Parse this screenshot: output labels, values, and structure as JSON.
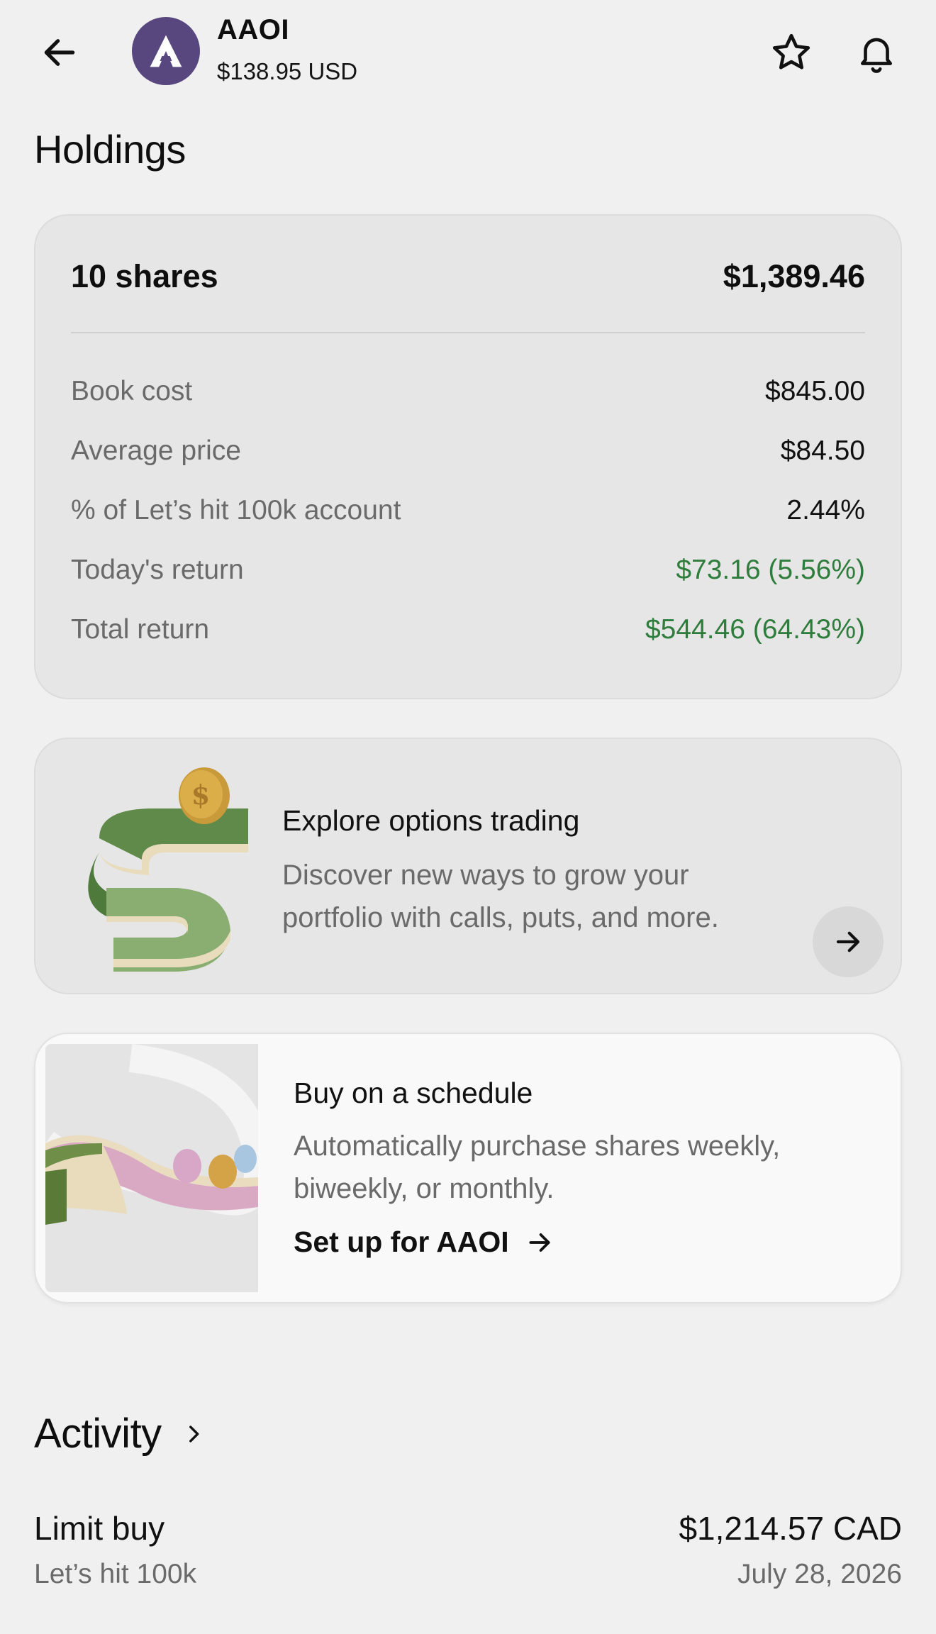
{
  "header": {
    "ticker": "AAOI",
    "price": "$138.95 USD",
    "logo_letter": "A",
    "logo_color": "#58467e"
  },
  "holdings": {
    "title": "Holdings",
    "shares": "10 shares",
    "market_value": "$1,389.46",
    "rows": [
      {
        "label": "Book cost",
        "value": "$845.00"
      },
      {
        "label": "Average price",
        "value": "$84.50"
      },
      {
        "label": "% of Let’s hit 100k account",
        "value": "2.44%"
      },
      {
        "label": "Today's return",
        "value": "$73.16 (5.56%)"
      },
      {
        "label": "Total return",
        "value": "$544.46 (64.43%)"
      }
    ],
    "positive_color": "#2f7d3c"
  },
  "options_promo": {
    "title": "Explore options trading",
    "description": "Discover new ways to grow your portfolio with calls, puts, and more.",
    "icon": "arrow-right-icon"
  },
  "schedule_promo": {
    "title": "Buy on a schedule",
    "description": "Automatically purchase shares weekly, biweekly, or monthly.",
    "link_label": "Set up for AAOI"
  },
  "activity": {
    "title": "Activity",
    "items": [
      {
        "type": "Limit buy",
        "account": "Let’s hit 100k",
        "amount": "$1,214.57 CAD",
        "date": "July 28, 2026"
      }
    ]
  }
}
